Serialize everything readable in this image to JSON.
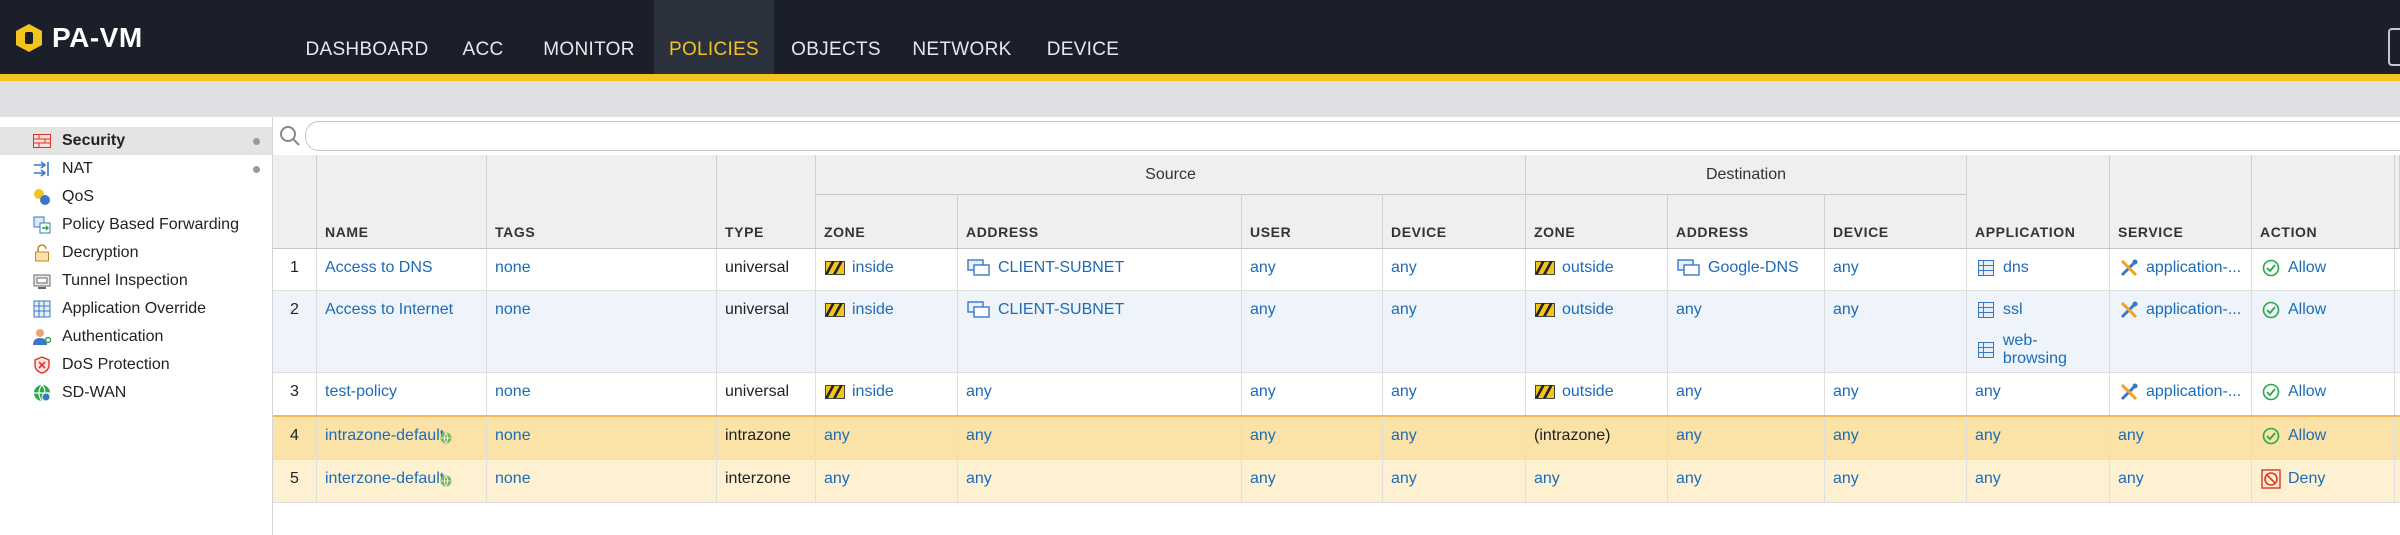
{
  "app": {
    "title": "PA-VM"
  },
  "nav": {
    "tabs": [
      {
        "label": "DASHBOARD"
      },
      {
        "label": "ACC"
      },
      {
        "label": "MONITOR"
      },
      {
        "label": "POLICIES",
        "active": true
      },
      {
        "label": "OBJECTS"
      },
      {
        "label": "NETWORK"
      },
      {
        "label": "DEVICE"
      }
    ]
  },
  "sidebar": {
    "items": [
      {
        "label": "Security",
        "icon": "security-icon",
        "active": true,
        "dot": true
      },
      {
        "label": "NAT",
        "icon": "nat-icon",
        "dot": true
      },
      {
        "label": "QoS",
        "icon": "qos-icon"
      },
      {
        "label": "Policy Based Forwarding",
        "icon": "pbf-icon"
      },
      {
        "label": "Decryption",
        "icon": "decryption-icon"
      },
      {
        "label": "Tunnel Inspection",
        "icon": "tunnel-inspection-icon"
      },
      {
        "label": "Application Override",
        "icon": "app-override-icon"
      },
      {
        "label": "Authentication",
        "icon": "authentication-icon"
      },
      {
        "label": "DoS Protection",
        "icon": "dos-protection-icon"
      },
      {
        "label": "SD-WAN",
        "icon": "sdwan-icon"
      }
    ]
  },
  "search": {
    "value": "",
    "placeholder": ""
  },
  "table": {
    "groups": {
      "source": "Source",
      "destination": "Destination"
    },
    "columns": {
      "name": "NAME",
      "tags": "TAGS",
      "type": "TYPE",
      "src_zone": "ZONE",
      "src_address": "ADDRESS",
      "src_user": "USER",
      "src_device": "DEVICE",
      "dst_zone": "ZONE",
      "dst_address": "ADDRESS",
      "dst_device": "DEVICE",
      "application": "APPLICATION",
      "service": "SERVICE",
      "action": "ACTION"
    },
    "rows": [
      {
        "num": "1",
        "name": "Access to DNS",
        "tags": "none",
        "type": "universal",
        "src_zone": "inside",
        "src_address": "CLIENT-SUBNET",
        "src_user": "any",
        "src_device": "any",
        "dst_zone": "outside",
        "dst_address": "Google-DNS",
        "dst_device": "any",
        "applications": [
          "dns"
        ],
        "service": "application-...",
        "action": "Allow"
      },
      {
        "num": "2",
        "name": "Access to Internet",
        "tags": "none",
        "type": "universal",
        "src_zone": "inside",
        "src_address": "CLIENT-SUBNET",
        "src_user": "any",
        "src_device": "any",
        "dst_zone": "outside",
        "dst_address": "any",
        "dst_device": "any",
        "applications": [
          "ssl",
          "web-browsing"
        ],
        "service": "application-...",
        "action": "Allow"
      },
      {
        "num": "3",
        "name": "test-policy",
        "tags": "none",
        "type": "universal",
        "src_zone": "inside",
        "src_address": "any",
        "src_user": "any",
        "src_device": "any",
        "dst_zone": "outside",
        "dst_address": "any",
        "dst_device": "any",
        "applications": [
          "any"
        ],
        "service": "application-...",
        "action": "Allow"
      },
      {
        "num": "4",
        "name": "intrazone-default",
        "tags": "none",
        "type": "intrazone",
        "src_zone": "any",
        "src_address": "any",
        "src_user": "any",
        "src_device": "any",
        "dst_zone": "(intrazone)",
        "dst_address": "any",
        "dst_device": "any",
        "applications": [
          "any"
        ],
        "service": "any",
        "action": "Allow"
      },
      {
        "num": "5",
        "name": "interzone-default",
        "tags": "none",
        "type": "interzone",
        "src_zone": "any",
        "src_address": "any",
        "src_user": "any",
        "src_device": "any",
        "dst_zone": "any",
        "dst_address": "any",
        "dst_device": "any",
        "applications": [
          "any"
        ],
        "service": "any",
        "action": "Deny"
      }
    ]
  },
  "colors": {
    "nav_bg": "#1a1f29",
    "accent": "#f2c41d",
    "link": "#1d6bb8",
    "allow": "#2aa84a",
    "deny": "#d9342b",
    "default_row": "#fdf1d2",
    "default_row_highlight": "#fbe3a8"
  }
}
